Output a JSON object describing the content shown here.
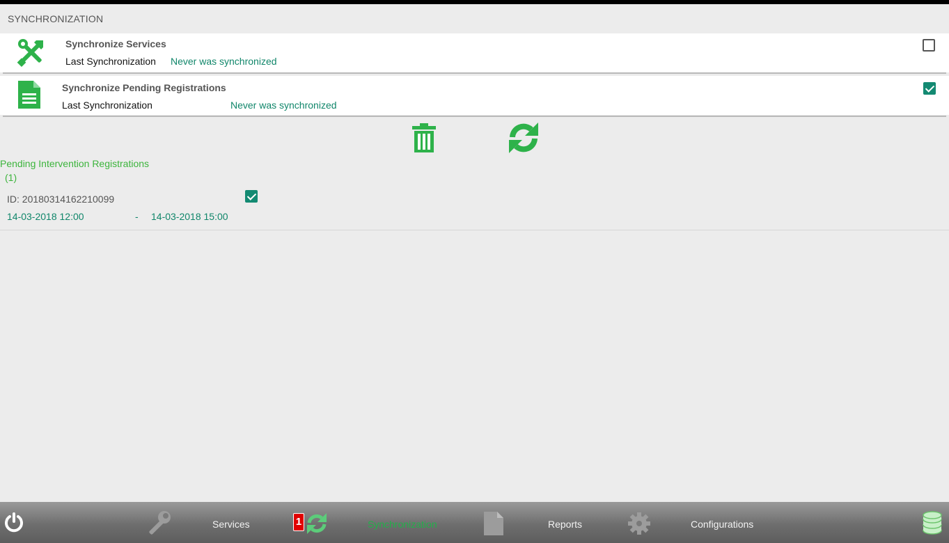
{
  "header": {
    "title": "SYNCHRONIZATION"
  },
  "sync_items": [
    {
      "title": "Synchronize Services",
      "label": "Last Synchronization",
      "status": "Never was synchronized",
      "checked": false,
      "icon": "tools-icon"
    },
    {
      "title": "Synchronize Pending Registrations",
      "label": "Last Synchronization",
      "status": "Never was synchronized",
      "checked": true,
      "icon": "document-icon"
    }
  ],
  "actions": {
    "delete_icon": "trash-icon",
    "sync_icon": "refresh-icon"
  },
  "pending": {
    "title": "Pending Intervention Registrations",
    "count": "(1)",
    "items": [
      {
        "id": "ID: 20180314162210099",
        "start": "14-03-2018 12:00",
        "separator": "-",
        "end": "14-03-2018 15:00",
        "checked": true
      }
    ]
  },
  "nav": {
    "items": [
      {
        "label": "Services",
        "icon": "wrench-icon"
      },
      {
        "label": "Synchronization",
        "icon": "sync-icon",
        "badge": "1",
        "active": true
      },
      {
        "label": "Reports",
        "icon": "document-icon"
      },
      {
        "label": "Configurations",
        "icon": "gear-icon"
      }
    ],
    "power_icon": "power-icon",
    "database_icon": "database-icon"
  },
  "colors": {
    "accent_green": "#3cb43c",
    "status_teal": "#10866a",
    "checkbox": "#138a72",
    "badge_red": "#e00000"
  }
}
